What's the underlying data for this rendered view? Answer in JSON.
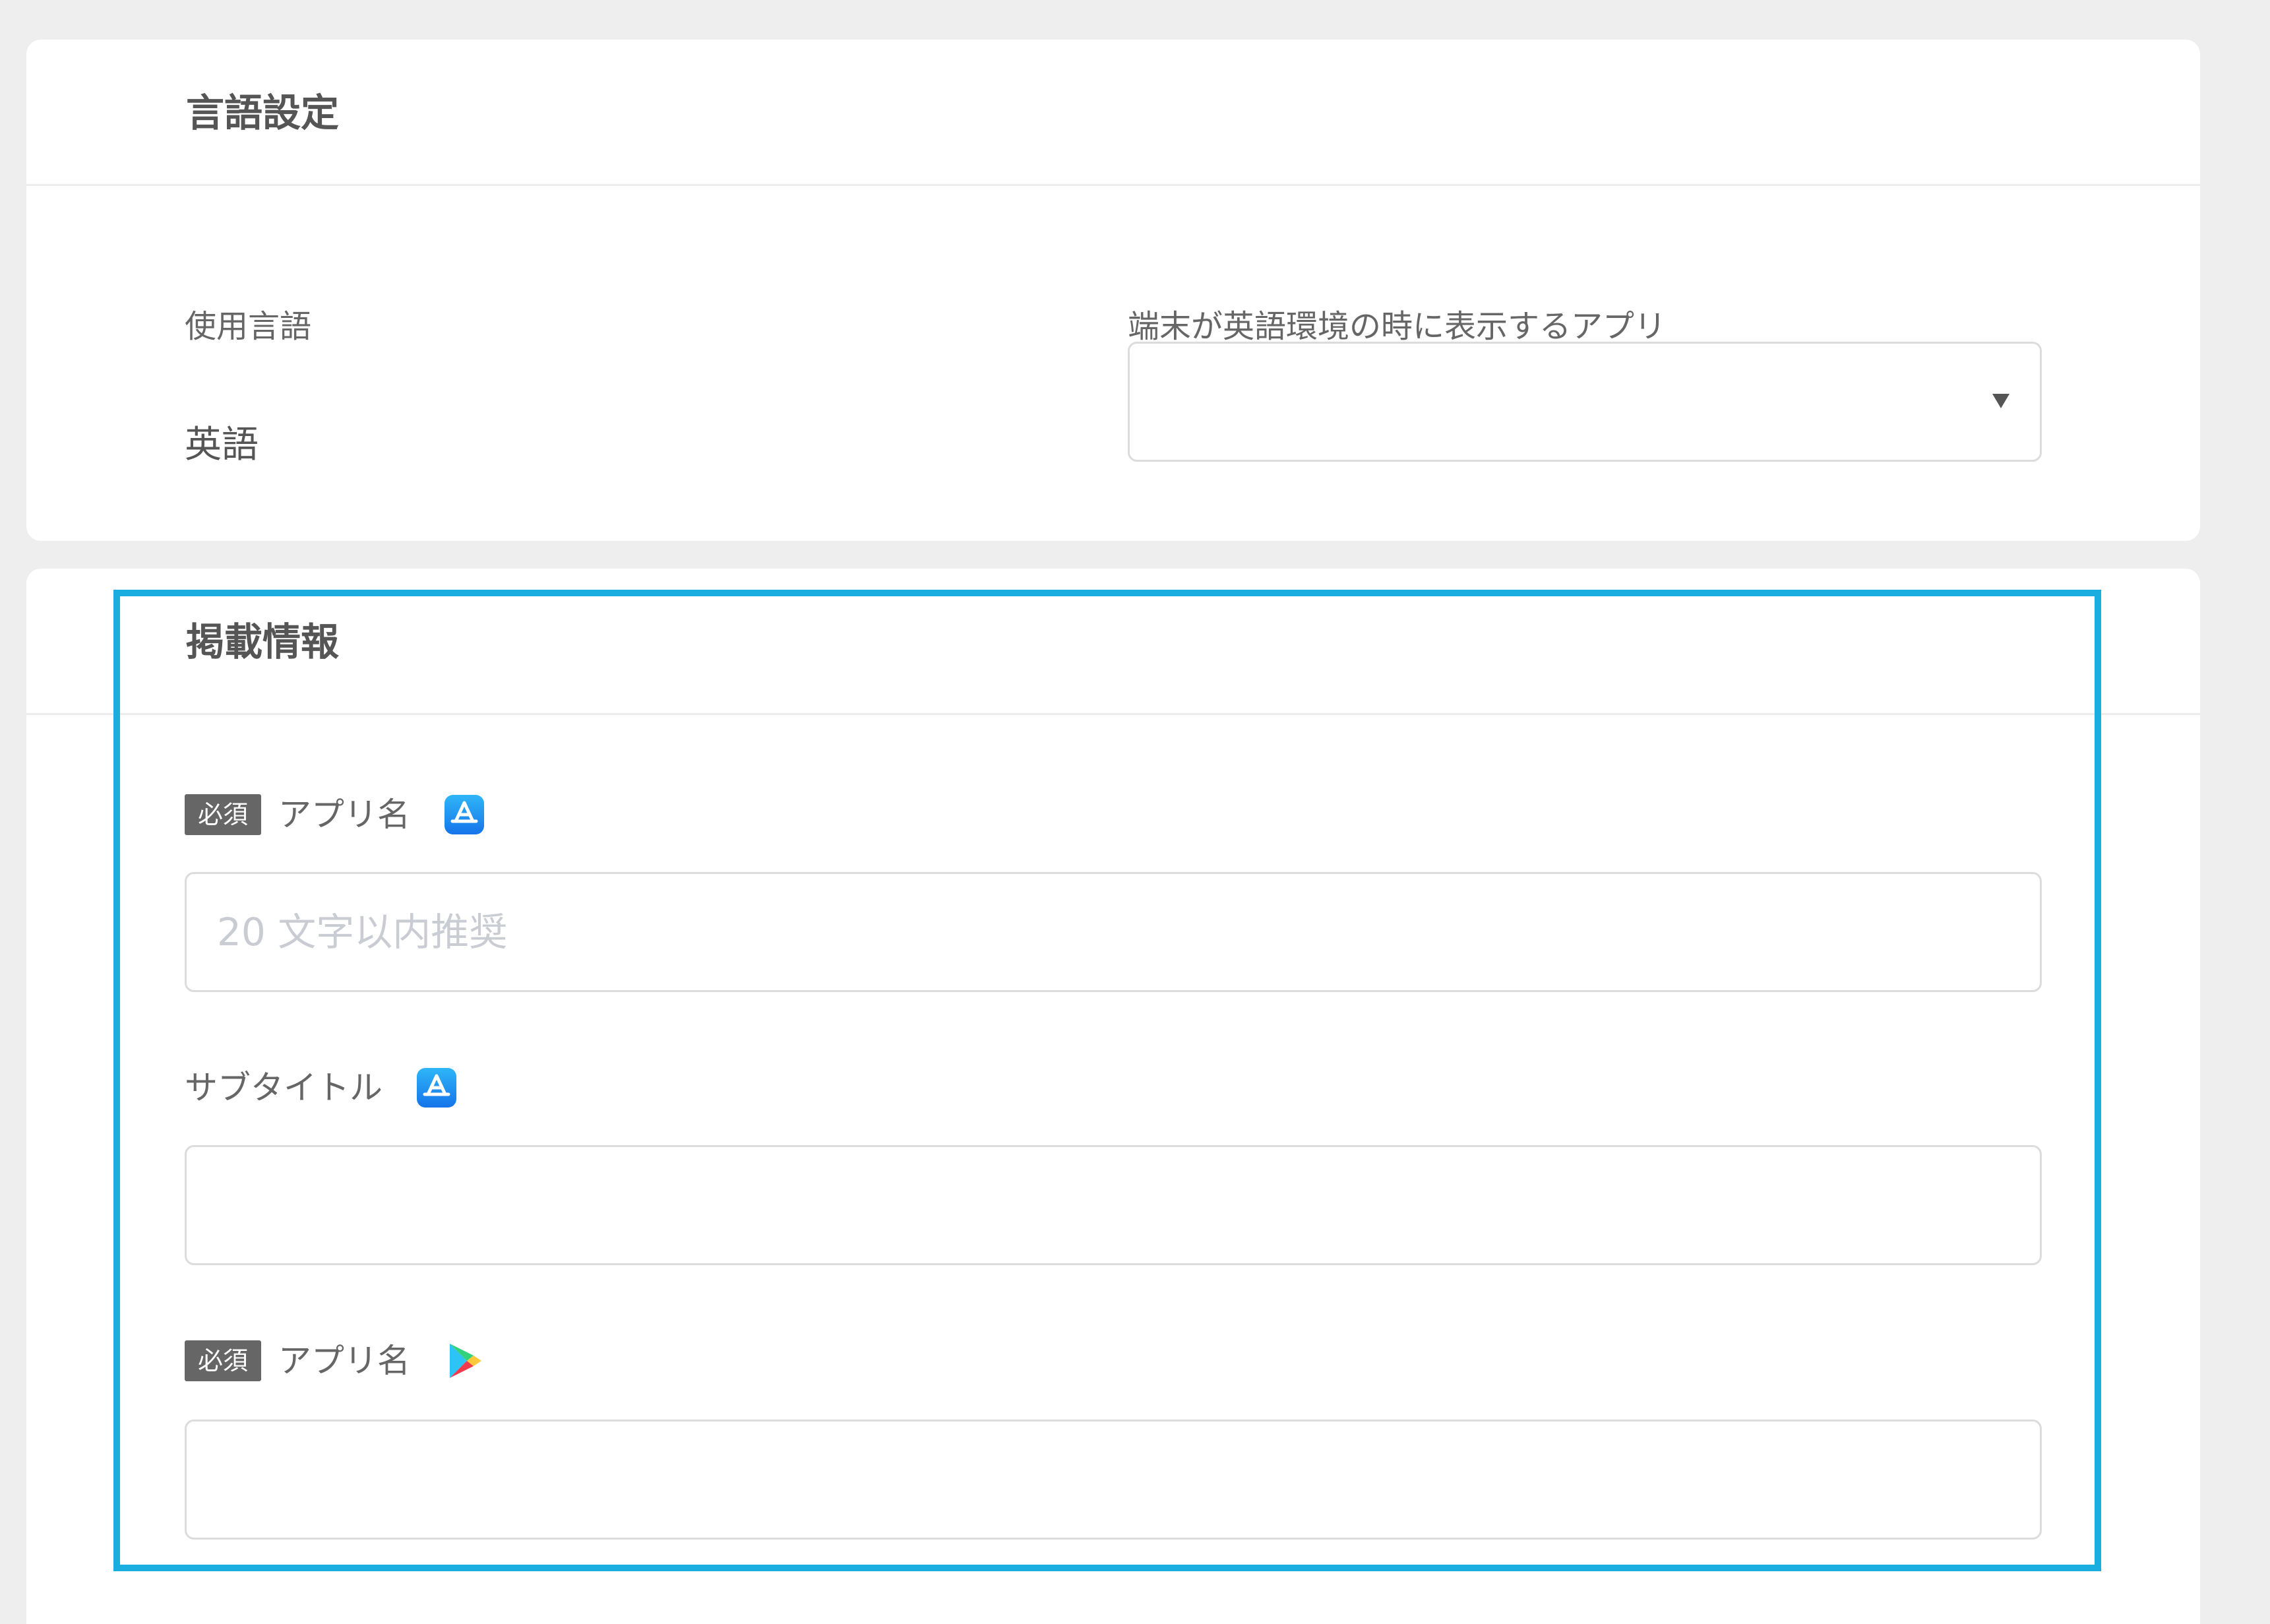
{
  "language_section": {
    "title": "言語設定",
    "used_language_label": "使用言語",
    "used_language_value": "英語",
    "english_app_label": "端末が英語環境の時に表示するアプリ",
    "english_app_select_value": ""
  },
  "listing_section": {
    "title": "掲載情報",
    "required_badge": "必須",
    "fields": [
      {
        "label": "アプリ名",
        "required": true,
        "store_icon": "app-store-icon",
        "placeholder": "20 文字以内推奨",
        "value": ""
      },
      {
        "label": "サブタイトル",
        "required": false,
        "store_icon": "app-store-icon",
        "placeholder": "",
        "value": ""
      },
      {
        "label": "アプリ名",
        "required": true,
        "store_icon": "google-play-icon",
        "placeholder": "",
        "value": ""
      }
    ]
  },
  "colors": {
    "page_background": "#eeeeee",
    "card_background": "#ffffff",
    "highlight_border": "#1aaee0",
    "badge_background": "#666666",
    "app_store_blue": "#1a8cf0"
  }
}
